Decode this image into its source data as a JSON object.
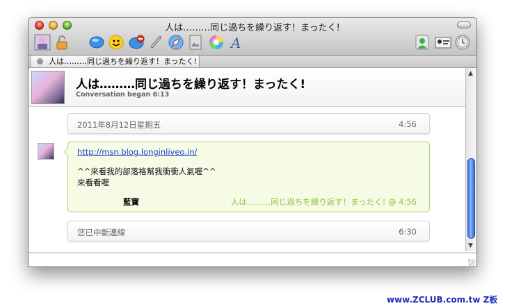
{
  "window": {
    "title": "人は………同じ過ちを繰り返す！まったく!"
  },
  "tab": {
    "label": "人は………同じ過ちを繰り返す！まったく!"
  },
  "header": {
    "title": "人は………同じ過ちを繰り返す！まったく!",
    "subtitle": "Conversation began 6:13"
  },
  "date_row": {
    "label": "2011年8月12日星期五",
    "time": "4:56"
  },
  "message": {
    "link": "http://msn.blog.longinliveo.in/",
    "line1": "^^來看我的部落格幫我衝衝人氣喔^^",
    "line2": "來看看喔",
    "sender": "藍寶",
    "meta": "人は………同じ過ちを繰り返す！まったく! @ 4:56"
  },
  "status_row": {
    "label": "您已中斷連線",
    "time": "6:30"
  },
  "watermark": "www.ZCLUB.com.tw Z板",
  "toolbar_icons": [
    "avatar-icon",
    "lock-icon",
    "bubble-icon",
    "smiley-icon",
    "block-icon",
    "attachment-icon",
    "safari-icon",
    "image-icon",
    "color-wheel-icon",
    "font-icon",
    "user-status-icon",
    "contact-card-icon",
    "history-icon"
  ],
  "colors": {
    "bubble_border": "#a9d36a",
    "bubble_meta": "#8cc43a",
    "link": "#1a3fcf",
    "scroll_thumb": "#2d6fe0"
  }
}
